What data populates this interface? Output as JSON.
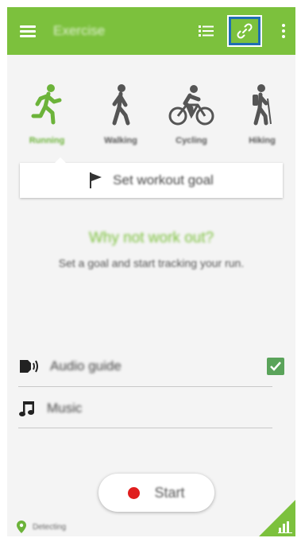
{
  "header": {
    "title": "Exercise",
    "icons": [
      "menu-icon",
      "list-icon",
      "link-icon",
      "more-icon"
    ]
  },
  "activities": [
    {
      "label": "Running",
      "icon": "running-icon",
      "selected": true
    },
    {
      "label": "Walking",
      "icon": "walking-icon",
      "selected": false
    },
    {
      "label": "Cycling",
      "icon": "cycling-icon",
      "selected": false
    },
    {
      "label": "Hiking",
      "icon": "hiking-icon",
      "selected": false
    }
  ],
  "goal": {
    "label": "Set workout goal",
    "icon": "flag-icon"
  },
  "prompt": {
    "headline": "Why not work out?",
    "subtext": "Set a goal and start tracking your run."
  },
  "options": {
    "audio_guide": {
      "label": "Audio guide",
      "checked": true,
      "icon": "speaker-icon"
    },
    "music": {
      "label": "Music",
      "icon": "music-note-icon"
    }
  },
  "start": {
    "label": "Start"
  },
  "status": {
    "text": "Detecting",
    "icon": "location-pin-icon"
  },
  "stats": {
    "icon": "bar-chart-icon"
  },
  "colors": {
    "accent": "#7cc13d",
    "record": "#e01e1e",
    "checkbox": "#5aa35a",
    "highlight": "#1f6fb2"
  }
}
